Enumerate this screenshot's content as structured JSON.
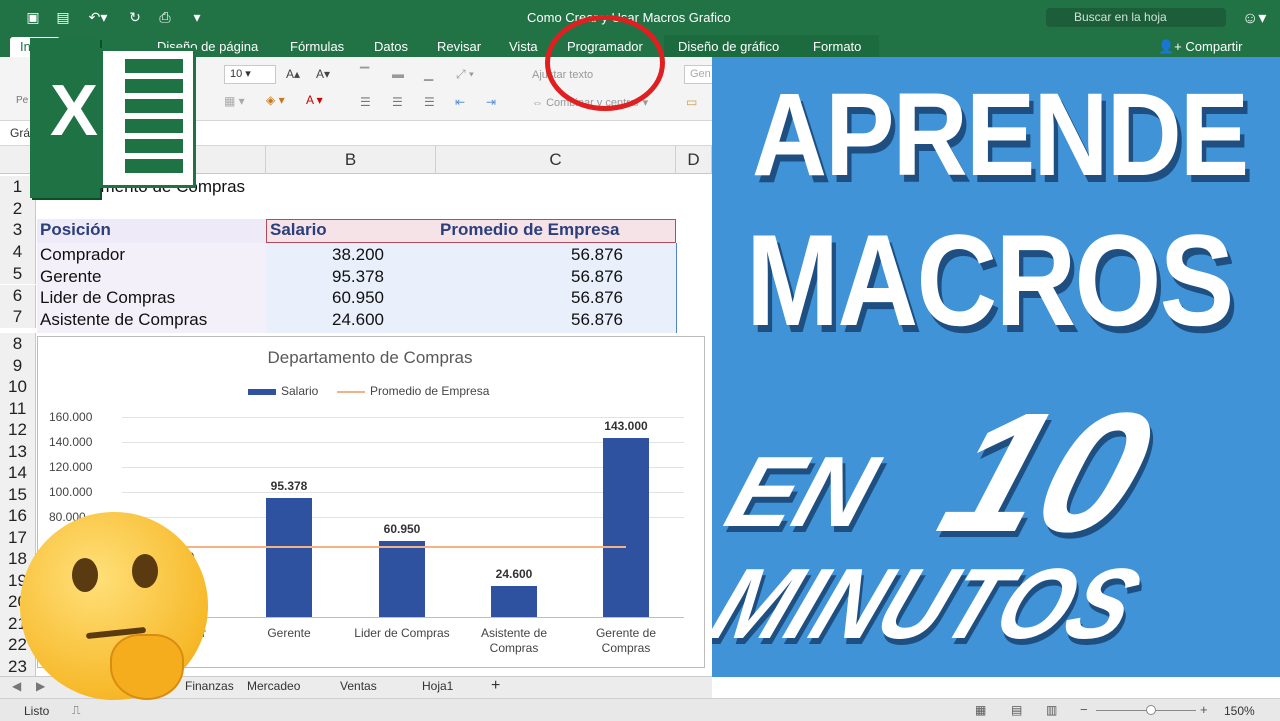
{
  "window": {
    "title": "Como Crear y Usar Macros Grafico"
  },
  "search": {
    "placeholder": "Buscar en la hoja"
  },
  "tabs": [
    "Inicio",
    "Diseño de página",
    "Fórmulas",
    "Datos",
    "Revisar",
    "Vista",
    "Programador",
    "Diseño de gráfico",
    "Formato"
  ],
  "share_label": "Compartir",
  "ribbon": {
    "font_size": "10",
    "wrap_text": "Ajustar texto",
    "merge_center": "Combinar y centrar",
    "number_format": "Gen",
    "paste_label": "Pe"
  },
  "name_box": "Grá",
  "columns": [
    "B",
    "C",
    "D"
  ],
  "rows": [
    "1",
    "2",
    "3",
    "4",
    "5",
    "6",
    "7",
    "8",
    "9",
    "10",
    "11",
    "12",
    "13",
    "14",
    "15",
    "16",
    "17",
    "18",
    "19",
    "20",
    "21",
    "22",
    "23"
  ],
  "sheet": {
    "a1": "Departamento de Compras",
    "headers": [
      "Posición",
      "Salario",
      "Promedio de Empresa"
    ],
    "data": [
      {
        "pos": "Comprador",
        "sal": "38.200",
        "prom": "56.876"
      },
      {
        "pos": "Gerente",
        "sal": "95.378",
        "prom": "56.876"
      },
      {
        "pos": "Lider de Compras",
        "sal": "60.950",
        "prom": "56.876"
      },
      {
        "pos": "Asistente de Compras",
        "sal": "24.600",
        "prom": "56.876"
      }
    ]
  },
  "chart_data": {
    "type": "bar",
    "title": "Departamento de Compras",
    "categories": [
      "Comprador",
      "Gerente",
      "Lider de Compras",
      "Asistente de Compras",
      "Gerente de Compras"
    ],
    "series": [
      {
        "name": "Salario",
        "values": [
          38200,
          95378,
          60950,
          24600,
          143000
        ],
        "color": "#2f52a0"
      },
      {
        "name": "Promedio de Empresa",
        "values": [
          56876,
          56876,
          56876,
          56876,
          56876
        ],
        "color": "#f4b183"
      }
    ],
    "data_labels": [
      "38.200",
      "95.378",
      "60.950",
      "24.600",
      "143.000"
    ],
    "y_ticks": [
      "80.000",
      "100.000",
      "120.000",
      "140.000",
      "160.000"
    ],
    "ylim": [
      0,
      160000
    ],
    "legend": "top"
  },
  "sheet_tabs": [
    "Finanzas",
    "Mercadeo",
    "Ventas",
    "Hoja1"
  ],
  "status": {
    "ready": "Listo",
    "zoom": "150%"
  },
  "promo": {
    "line1": "APRENDE",
    "line2": "MACROS",
    "line3": "EN",
    "line4": "10",
    "line5": "MINUTOS"
  },
  "logo_letter": "X",
  "colors": {
    "excel_green": "#217346",
    "bar_blue": "#2f52a0",
    "promo_blue": "#3f93d6"
  }
}
